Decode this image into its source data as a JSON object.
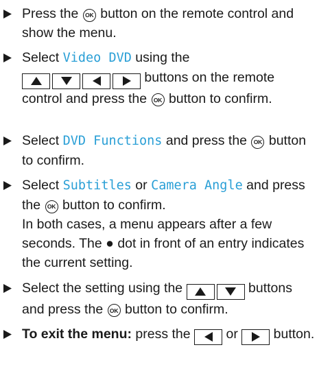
{
  "steps": [
    {
      "a": "Press the",
      "b": "button on the remote control and show the menu."
    },
    {
      "a": "Select",
      "ui": "Video DVD",
      "b": "using the",
      "c": "buttons on the remote control and press the",
      "d": "button to confirm."
    },
    {
      "a": "Select",
      "ui": "DVD Functions",
      "b": "and press the",
      "c": "button to confirm."
    },
    {
      "a": "Select",
      "ui1": "Subtitles",
      "b": "or",
      "ui2": "Camera Angle",
      "c": "and press the",
      "d": "button to confirm.",
      "note": "In both cases, a menu appears after a few seconds. The ● dot in front of an entry indicates the current setting."
    },
    {
      "a": "Select the setting using the",
      "b": "buttons and press the",
      "c": "button to confirm."
    },
    {
      "bold": "To exit the menu:",
      "a": "press the",
      "b": "or",
      "c": "button."
    }
  ],
  "ok_label": "OK"
}
